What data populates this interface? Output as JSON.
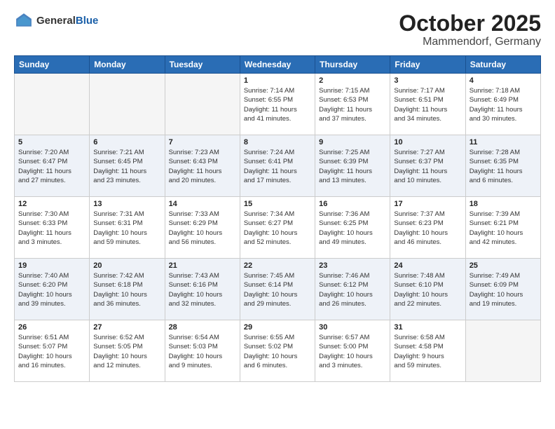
{
  "header": {
    "logo_general": "General",
    "logo_blue": "Blue",
    "title": "October 2025",
    "subtitle": "Mammendorf, Germany"
  },
  "weekdays": [
    "Sunday",
    "Monday",
    "Tuesday",
    "Wednesday",
    "Thursday",
    "Friday",
    "Saturday"
  ],
  "weeks": [
    [
      {
        "day": "",
        "detail": ""
      },
      {
        "day": "",
        "detail": ""
      },
      {
        "day": "",
        "detail": ""
      },
      {
        "day": "1",
        "detail": "Sunrise: 7:14 AM\nSunset: 6:55 PM\nDaylight: 11 hours\nand 41 minutes."
      },
      {
        "day": "2",
        "detail": "Sunrise: 7:15 AM\nSunset: 6:53 PM\nDaylight: 11 hours\nand 37 minutes."
      },
      {
        "day": "3",
        "detail": "Sunrise: 7:17 AM\nSunset: 6:51 PM\nDaylight: 11 hours\nand 34 minutes."
      },
      {
        "day": "4",
        "detail": "Sunrise: 7:18 AM\nSunset: 6:49 PM\nDaylight: 11 hours\nand 30 minutes."
      }
    ],
    [
      {
        "day": "5",
        "detail": "Sunrise: 7:20 AM\nSunset: 6:47 PM\nDaylight: 11 hours\nand 27 minutes."
      },
      {
        "day": "6",
        "detail": "Sunrise: 7:21 AM\nSunset: 6:45 PM\nDaylight: 11 hours\nand 23 minutes."
      },
      {
        "day": "7",
        "detail": "Sunrise: 7:23 AM\nSunset: 6:43 PM\nDaylight: 11 hours\nand 20 minutes."
      },
      {
        "day": "8",
        "detail": "Sunrise: 7:24 AM\nSunset: 6:41 PM\nDaylight: 11 hours\nand 17 minutes."
      },
      {
        "day": "9",
        "detail": "Sunrise: 7:25 AM\nSunset: 6:39 PM\nDaylight: 11 hours\nand 13 minutes."
      },
      {
        "day": "10",
        "detail": "Sunrise: 7:27 AM\nSunset: 6:37 PM\nDaylight: 11 hours\nand 10 minutes."
      },
      {
        "day": "11",
        "detail": "Sunrise: 7:28 AM\nSunset: 6:35 PM\nDaylight: 11 hours\nand 6 minutes."
      }
    ],
    [
      {
        "day": "12",
        "detail": "Sunrise: 7:30 AM\nSunset: 6:33 PM\nDaylight: 11 hours\nand 3 minutes."
      },
      {
        "day": "13",
        "detail": "Sunrise: 7:31 AM\nSunset: 6:31 PM\nDaylight: 10 hours\nand 59 minutes."
      },
      {
        "day": "14",
        "detail": "Sunrise: 7:33 AM\nSunset: 6:29 PM\nDaylight: 10 hours\nand 56 minutes."
      },
      {
        "day": "15",
        "detail": "Sunrise: 7:34 AM\nSunset: 6:27 PM\nDaylight: 10 hours\nand 52 minutes."
      },
      {
        "day": "16",
        "detail": "Sunrise: 7:36 AM\nSunset: 6:25 PM\nDaylight: 10 hours\nand 49 minutes."
      },
      {
        "day": "17",
        "detail": "Sunrise: 7:37 AM\nSunset: 6:23 PM\nDaylight: 10 hours\nand 46 minutes."
      },
      {
        "day": "18",
        "detail": "Sunrise: 7:39 AM\nSunset: 6:21 PM\nDaylight: 10 hours\nand 42 minutes."
      }
    ],
    [
      {
        "day": "19",
        "detail": "Sunrise: 7:40 AM\nSunset: 6:20 PM\nDaylight: 10 hours\nand 39 minutes."
      },
      {
        "day": "20",
        "detail": "Sunrise: 7:42 AM\nSunset: 6:18 PM\nDaylight: 10 hours\nand 36 minutes."
      },
      {
        "day": "21",
        "detail": "Sunrise: 7:43 AM\nSunset: 6:16 PM\nDaylight: 10 hours\nand 32 minutes."
      },
      {
        "day": "22",
        "detail": "Sunrise: 7:45 AM\nSunset: 6:14 PM\nDaylight: 10 hours\nand 29 minutes."
      },
      {
        "day": "23",
        "detail": "Sunrise: 7:46 AM\nSunset: 6:12 PM\nDaylight: 10 hours\nand 26 minutes."
      },
      {
        "day": "24",
        "detail": "Sunrise: 7:48 AM\nSunset: 6:10 PM\nDaylight: 10 hours\nand 22 minutes."
      },
      {
        "day": "25",
        "detail": "Sunrise: 7:49 AM\nSunset: 6:09 PM\nDaylight: 10 hours\nand 19 minutes."
      }
    ],
    [
      {
        "day": "26",
        "detail": "Sunrise: 6:51 AM\nSunset: 5:07 PM\nDaylight: 10 hours\nand 16 minutes."
      },
      {
        "day": "27",
        "detail": "Sunrise: 6:52 AM\nSunset: 5:05 PM\nDaylight: 10 hours\nand 12 minutes."
      },
      {
        "day": "28",
        "detail": "Sunrise: 6:54 AM\nSunset: 5:03 PM\nDaylight: 10 hours\nand 9 minutes."
      },
      {
        "day": "29",
        "detail": "Sunrise: 6:55 AM\nSunset: 5:02 PM\nDaylight: 10 hours\nand 6 minutes."
      },
      {
        "day": "30",
        "detail": "Sunrise: 6:57 AM\nSunset: 5:00 PM\nDaylight: 10 hours\nand 3 minutes."
      },
      {
        "day": "31",
        "detail": "Sunrise: 6:58 AM\nSunset: 4:58 PM\nDaylight: 9 hours\nand 59 minutes."
      },
      {
        "day": "",
        "detail": ""
      }
    ]
  ]
}
